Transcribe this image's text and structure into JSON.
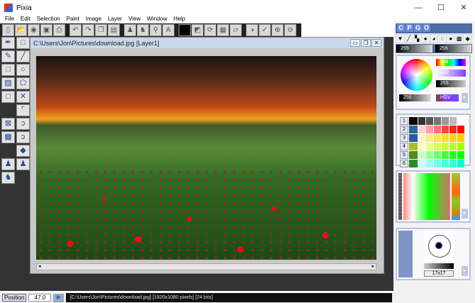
{
  "window": {
    "title": "Pixia",
    "buttons": [
      "—",
      "☐",
      "✕"
    ]
  },
  "menu": [
    "File",
    "Edit",
    "Selection",
    "Paint",
    "Image",
    "Layer",
    "View",
    "Window",
    "Help"
  ],
  "toolbar": [
    {
      "icon": "new-icon",
      "g": "▯"
    },
    {
      "icon": "open-folder-icon",
      "g": "📂"
    },
    {
      "icon": "camera-icon",
      "g": "◉"
    },
    {
      "icon": "save-icon",
      "g": "▣"
    },
    {
      "icon": "print-icon",
      "g": "⎙"
    },
    {
      "icon": "undo-icon",
      "g": "↶"
    },
    {
      "icon": "redo-icon",
      "g": "↷"
    },
    {
      "icon": "copy-icon",
      "g": "❐"
    },
    {
      "icon": "paste-icon",
      "g": "▤"
    },
    {
      "icon": "stamp-icon",
      "g": "♟"
    },
    {
      "icon": "brush-icon",
      "g": "♞"
    },
    {
      "icon": "zoom-icon",
      "g": "⚲"
    },
    {
      "icon": "text-icon",
      "g": "A"
    },
    {
      "icon": "color-swatch-icon",
      "g": ""
    },
    {
      "icon": "resize-icon",
      "g": "◩"
    },
    {
      "icon": "rotate-icon",
      "g": "⟳"
    },
    {
      "icon": "layers-icon",
      "g": "▦"
    },
    {
      "icon": "page-icon",
      "g": "▱"
    },
    {
      "icon": "color-picker-icon",
      "g": "◑"
    },
    {
      "icon": "check-icon",
      "g": "✓"
    },
    {
      "icon": "zoom-in-icon",
      "g": "⊕"
    },
    {
      "icon": "zoom-out-icon",
      "g": "⊖"
    }
  ],
  "tools": [
    {
      "icon": "pen-icon",
      "g": "✒"
    },
    {
      "icon": "rect-select-icon",
      "g": "□"
    },
    {
      "icon": "pencil-icon",
      "g": "✎"
    },
    {
      "icon": "line-icon",
      "g": "╱"
    },
    {
      "icon": "rectangle-icon",
      "g": "□"
    },
    {
      "icon": "ellipse-icon",
      "g": "○"
    },
    {
      "icon": "gradient-icon",
      "g": "▨"
    },
    {
      "icon": "lasso-icon",
      "g": "⬠"
    },
    {
      "icon": "square-icon",
      "g": "□"
    },
    {
      "icon": "cross-icon",
      "g": "✕"
    },
    {
      "icon": "empty",
      "g": ""
    },
    {
      "icon": "curve-icon",
      "g": "⌜"
    },
    {
      "icon": "delete-select-icon",
      "g": "⊠"
    },
    {
      "icon": "bezier-icon",
      "g": "ↄ"
    },
    {
      "icon": "transparency-icon",
      "g": "▩"
    },
    {
      "icon": "bezier-edit-icon",
      "g": "ↄ"
    },
    {
      "icon": "empty",
      "g": ""
    },
    {
      "icon": "fill-shape-icon",
      "g": "◆"
    },
    {
      "icon": "stamp-red-icon",
      "g": "♟"
    },
    {
      "icon": "stamp-blue-icon",
      "g": "♟"
    },
    {
      "icon": "brush-red-icon",
      "g": "♞"
    },
    {
      "icon": "empty",
      "g": ""
    }
  ],
  "document": {
    "title": "C:\\Users\\Jon\\Pictures\\download.jpg [Layer1]",
    "buttons": [
      "▭",
      "❐",
      "✕"
    ],
    "scroll_left": "◂",
    "scroll_right": "▸"
  },
  "panel": {
    "tabs": [
      "C",
      "P",
      "G",
      "O"
    ],
    "brushes": [
      "▼",
      "╱",
      "▚",
      "●",
      "◕",
      "◌",
      "●",
      "▩",
      "◆"
    ],
    "values": [
      "255",
      "255"
    ],
    "color": {
      "hue": "244",
      "sat": "180",
      "val": "255",
      "alpha": "255",
      "mode": "HSV"
    },
    "palette_rows": [
      "1",
      "2",
      "3",
      "4",
      "5",
      "6"
    ],
    "brush_size": "17x17"
  },
  "status": {
    "position_label": "Position",
    "position_value": "47.0",
    "path": "[C:\\Users\\Jon\\Pictures\\download.jpg] [1920x1080 pixels] [24 bits]"
  },
  "colors": {
    "palette": [
      [
        "#000",
        "#333",
        "#555",
        "#777",
        "#999",
        "#bbb",
        "#fff"
      ],
      [
        "#2a6a9a",
        "#ffd0d8",
        "#ffa0a8",
        "#ff7070",
        "#ff4444",
        "#ff2020",
        "#ff0000"
      ],
      [
        "#2a5aaa",
        "#fff4c0",
        "#ffe890",
        "#ffe060",
        "#ffd840",
        "#ffd020",
        "#ffcc00"
      ],
      [
        "#aac020",
        "#f4ffc0",
        "#e8ff90",
        "#d8ff60",
        "#c8ff40",
        "#b8ff20",
        "#a8ff00"
      ],
      [
        "#508a20",
        "#c8ffc0",
        "#98ff90",
        "#70ff70",
        "#40ff40",
        "#20ff20",
        "#00ff00"
      ],
      [
        "#2a8a2a",
        "#c8fff8",
        "#a0fff0",
        "#70ffe8",
        "#50ffe0",
        "#30ffd8",
        "#00ffd0"
      ]
    ]
  }
}
